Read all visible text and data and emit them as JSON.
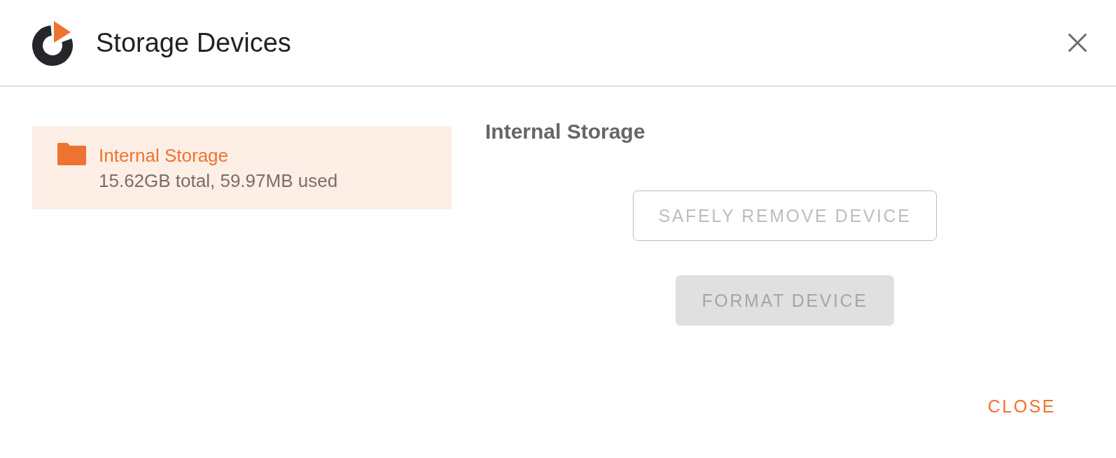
{
  "dialog": {
    "title": "Storage Devices"
  },
  "devices": [
    {
      "name": "Internal Storage",
      "summary": "15.62GB total, 59.97MB used",
      "selected": true
    }
  ],
  "detail": {
    "title": "Internal Storage",
    "actions": [
      {
        "label": "SAFELY REMOVE DEVICE",
        "kind": "outlined",
        "disabled": true
      },
      {
        "label": "FORMAT DEVICE",
        "kind": "filled",
        "disabled": true
      }
    ]
  },
  "footer": {
    "buttons": [
      {
        "label": "CLOSE"
      }
    ]
  }
}
